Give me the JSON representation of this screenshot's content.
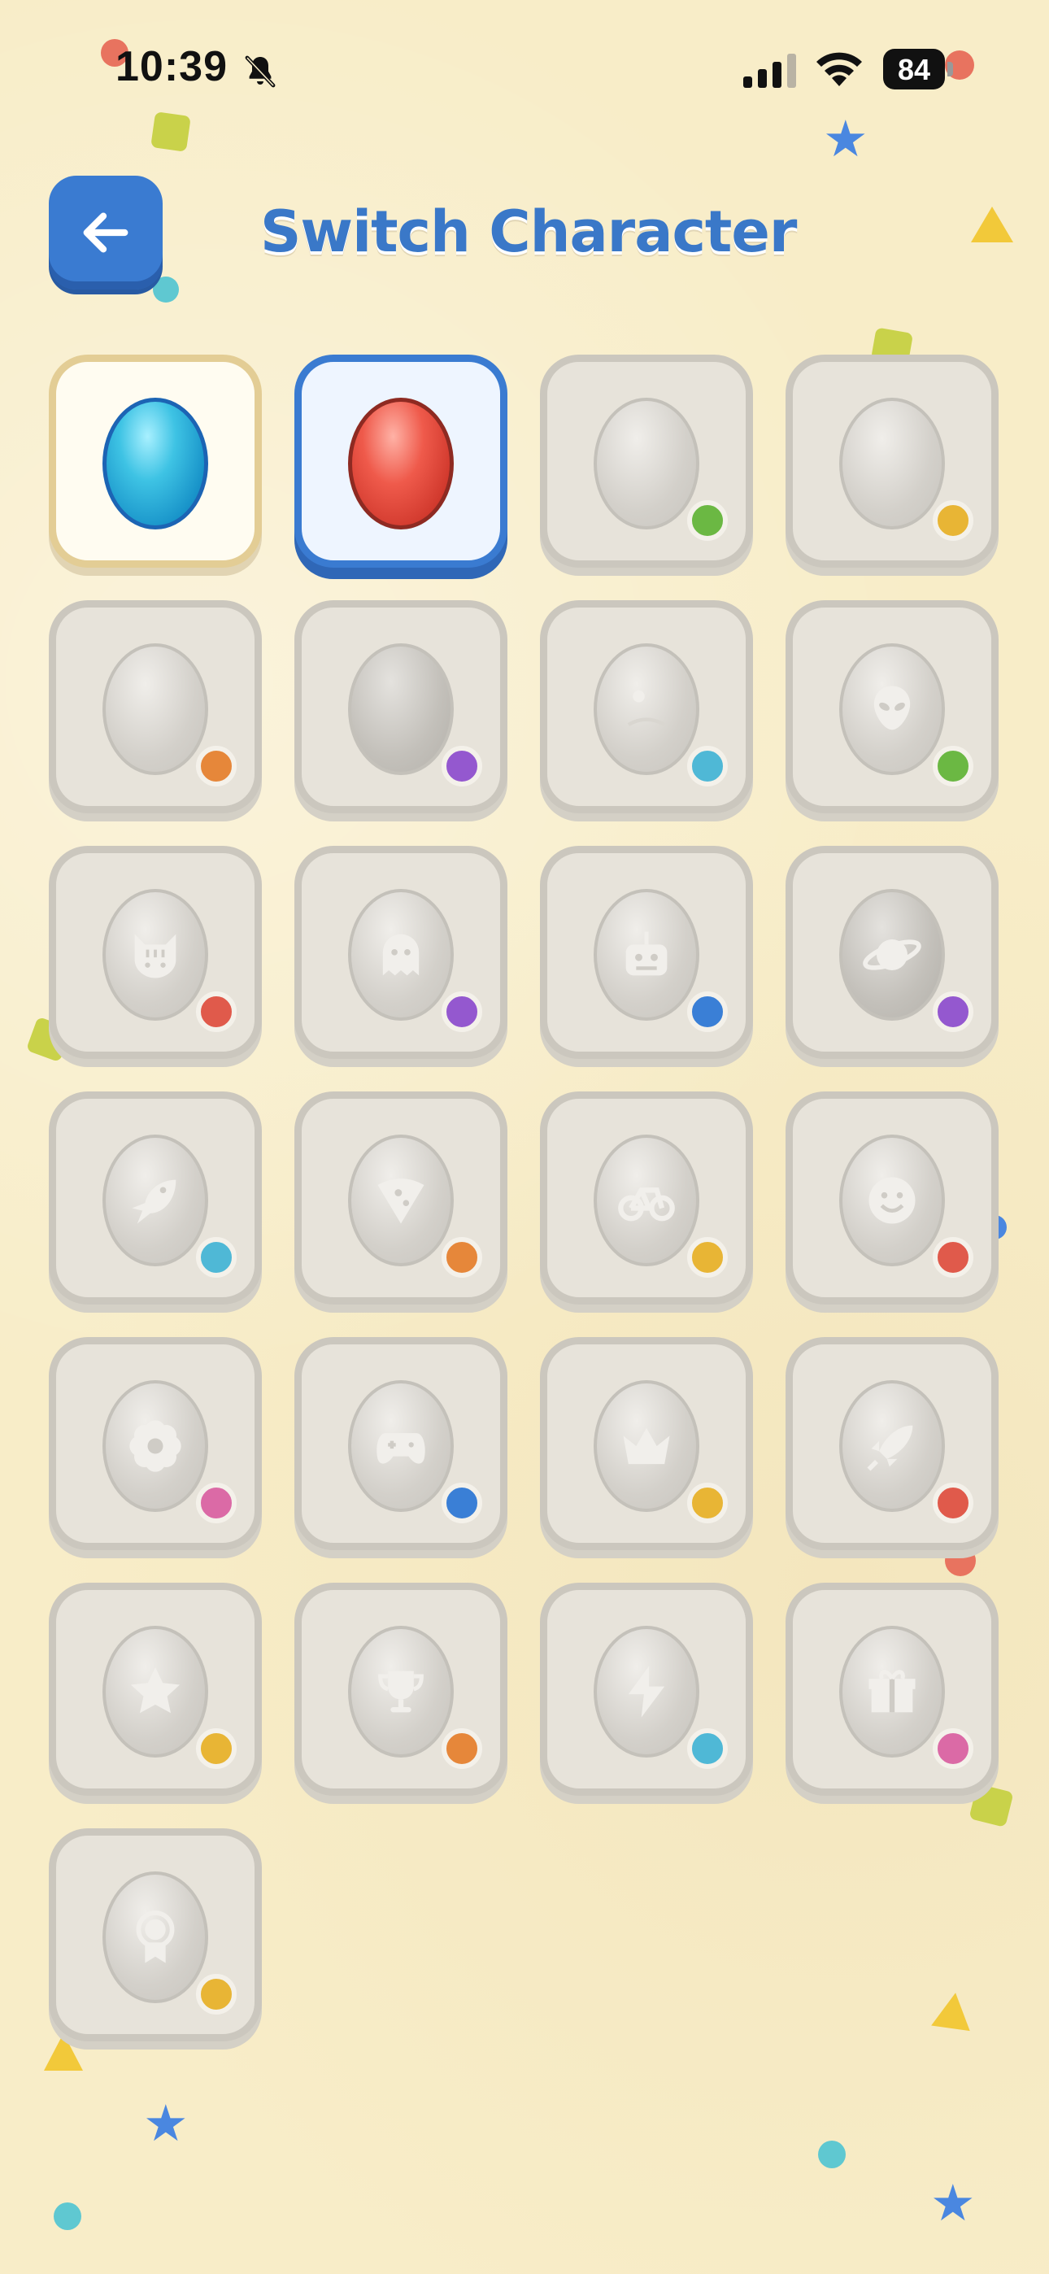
{
  "status_bar": {
    "time": "10:39",
    "battery": "84"
  },
  "header": {
    "title": "Switch Character",
    "back_icon": "arrow-left-icon"
  },
  "colors": {
    "accent_blue": "#3a7bd1",
    "background": "#f8edc8",
    "title_color": "#3a78c8"
  },
  "characters": [
    {
      "egg": "blue",
      "icon": "",
      "dot": "",
      "state": "owned"
    },
    {
      "egg": "red",
      "icon": "",
      "dot": "",
      "state": "selected"
    },
    {
      "egg": "locked",
      "icon": "",
      "dot": "#6bb843",
      "state": "locked"
    },
    {
      "egg": "locked",
      "icon": "",
      "dot": "#e8b535",
      "state": "locked"
    },
    {
      "egg": "locked",
      "icon": "",
      "dot": "#e6873a",
      "state": "locked"
    },
    {
      "egg": "locked-dark",
      "icon": "",
      "dot": "#9458cf",
      "state": "locked"
    },
    {
      "egg": "locked",
      "icon": "marble-icon",
      "dot": "#4fb8d6",
      "state": "locked"
    },
    {
      "egg": "locked",
      "icon": "alien-icon",
      "dot": "#6bb843",
      "state": "locked"
    },
    {
      "egg": "locked",
      "icon": "cat-icon",
      "dot": "#e05a4b",
      "state": "locked"
    },
    {
      "egg": "locked",
      "icon": "ghost-icon",
      "dot": "#9458cf",
      "state": "locked"
    },
    {
      "egg": "locked",
      "icon": "robot-icon",
      "dot": "#3a7fd6",
      "state": "locked"
    },
    {
      "egg": "locked-dark",
      "icon": "planet-icon",
      "dot": "#9458cf",
      "state": "locked"
    },
    {
      "egg": "locked",
      "icon": "fish-icon",
      "dot": "#4fb8d6",
      "state": "locked"
    },
    {
      "egg": "locked",
      "icon": "pizza-icon",
      "dot": "#e6873a",
      "state": "locked"
    },
    {
      "egg": "locked",
      "icon": "bicycle-icon",
      "dot": "#e8b535",
      "state": "locked"
    },
    {
      "egg": "locked",
      "icon": "smiley-icon",
      "dot": "#e05a4b",
      "state": "locked"
    },
    {
      "egg": "locked",
      "icon": "flower-icon",
      "dot": "#db6aa6",
      "state": "locked"
    },
    {
      "egg": "locked",
      "icon": "gamepad-icon",
      "dot": "#3a7fd6",
      "state": "locked"
    },
    {
      "egg": "locked",
      "icon": "crown-icon",
      "dot": "#e8b535",
      "state": "locked"
    },
    {
      "egg": "locked",
      "icon": "rocket-icon",
      "dot": "#e05a4b",
      "state": "locked"
    },
    {
      "egg": "locked",
      "icon": "star-icon",
      "dot": "#e8b535",
      "state": "locked"
    },
    {
      "egg": "locked",
      "icon": "trophy-icon",
      "dot": "#e6873a",
      "state": "locked"
    },
    {
      "egg": "locked",
      "icon": "lightning-icon",
      "dot": "#4fb8d6",
      "state": "locked"
    },
    {
      "egg": "locked",
      "icon": "gift-icon",
      "dot": "#db6aa6",
      "state": "locked"
    },
    {
      "egg": "locked",
      "icon": "award-ribbon-icon",
      "dot": "#e8b535",
      "state": "locked"
    }
  ]
}
